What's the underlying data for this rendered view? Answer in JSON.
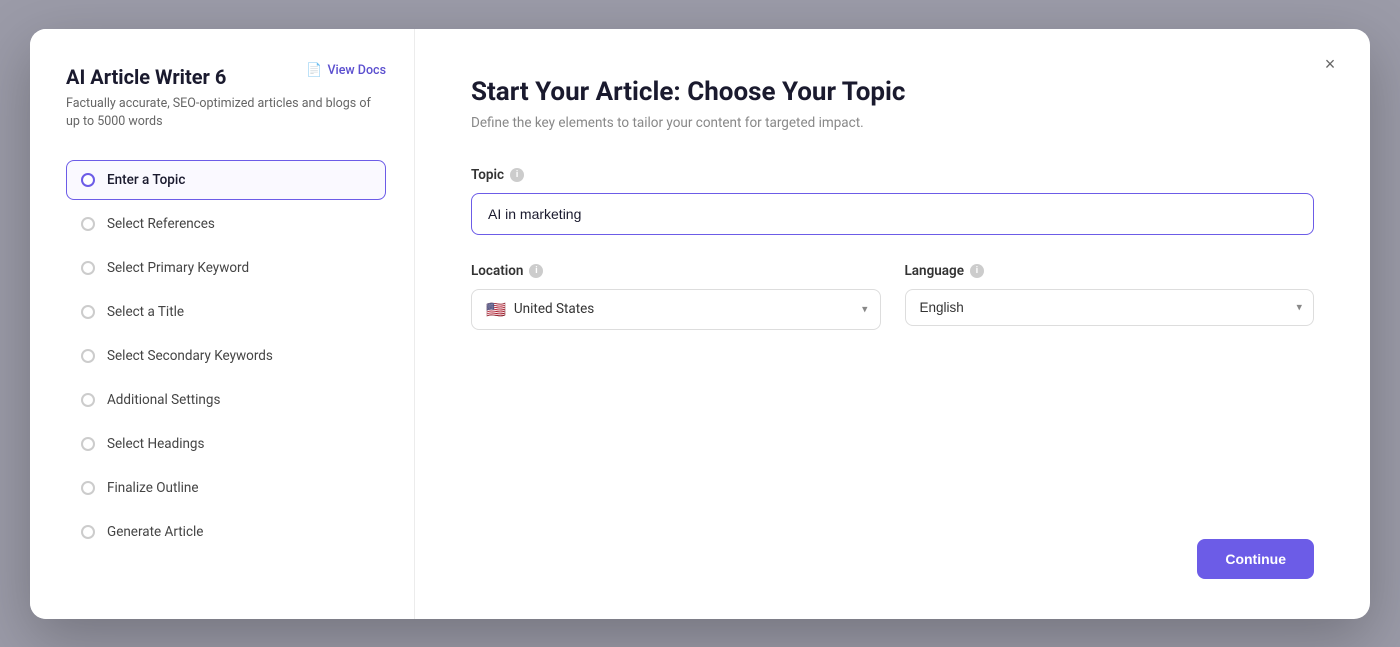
{
  "modal": {
    "close_label": "×"
  },
  "left_panel": {
    "title": "AI Article Writer 6",
    "subtitle": "Factually accurate, SEO-optimized articles and blogs of up to 5000 words",
    "view_docs_label": "View Docs",
    "steps": [
      {
        "id": "enter-topic",
        "label": "Enter a Topic",
        "active": true
      },
      {
        "id": "select-references",
        "label": "Select References",
        "active": false
      },
      {
        "id": "select-primary-keyword",
        "label": "Select Primary Keyword",
        "active": false
      },
      {
        "id": "select-title",
        "label": "Select a Title",
        "active": false
      },
      {
        "id": "select-secondary-keywords",
        "label": "Select Secondary Keywords",
        "active": false
      },
      {
        "id": "additional-settings",
        "label": "Additional Settings",
        "active": false
      },
      {
        "id": "select-headings",
        "label": "Select Headings",
        "active": false
      },
      {
        "id": "finalize-outline",
        "label": "Finalize Outline",
        "active": false
      },
      {
        "id": "generate-article",
        "label": "Generate Article",
        "active": false
      }
    ]
  },
  "right_panel": {
    "main_title": "Start Your Article: Choose Your Topic",
    "main_subtitle": "Define the key elements to tailor your content for targeted impact.",
    "topic_label": "Topic",
    "topic_value": "AI in marketing",
    "topic_placeholder": "AI in marketing",
    "location_label": "Location",
    "location_value": "United States",
    "language_label": "Language",
    "language_value": "English",
    "continue_label": "Continue"
  }
}
